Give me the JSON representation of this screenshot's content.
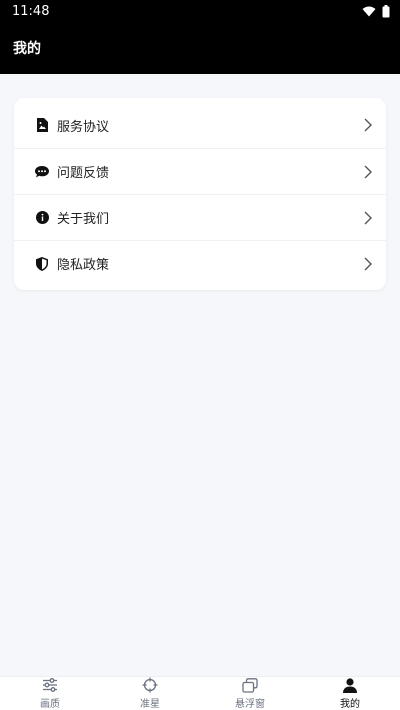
{
  "status_bar": {
    "time": "11:48"
  },
  "app_bar": {
    "title": "我的"
  },
  "menu": {
    "items": [
      {
        "label": "服务协议",
        "icon": "document-icon"
      },
      {
        "label": "问题反馈",
        "icon": "chat-bubble-icon"
      },
      {
        "label": "关于我们",
        "icon": "info-icon"
      },
      {
        "label": "隐私政策",
        "icon": "shield-icon"
      }
    ]
  },
  "tabs": [
    {
      "label": "画质",
      "icon": "sliders-icon",
      "active": false
    },
    {
      "label": "准星",
      "icon": "crosshair-icon",
      "active": false
    },
    {
      "label": "悬浮窗",
      "icon": "floating-window-icon",
      "active": false
    },
    {
      "label": "我的",
      "icon": "person-icon",
      "active": true
    }
  ],
  "colors": {
    "active_tab": "#111111",
    "inactive_tab": "#6b7280",
    "background": "#f5f7fb"
  }
}
